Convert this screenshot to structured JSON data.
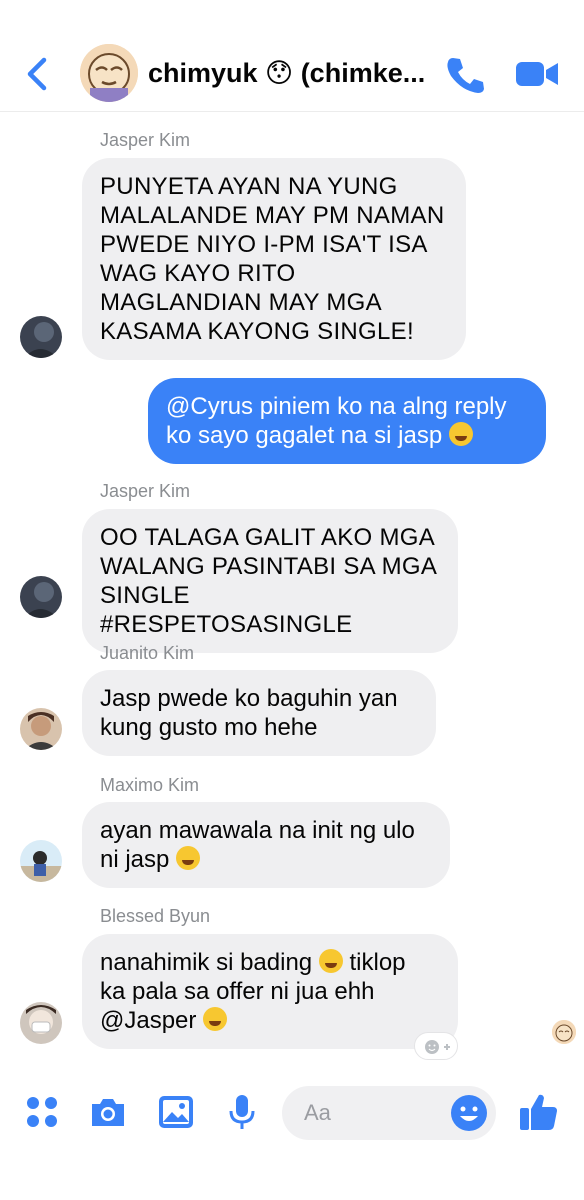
{
  "header": {
    "title": "chimyuk 😯 (chimke...",
    "accent_color": "#3a82f7"
  },
  "messages": [
    {
      "sender": "Jasper Kim",
      "text": "PUNYETA AYAN NA YUNG\nMALALANDE MAY PM NAMAN\nPWEDE NIYO I-PM ISA'T ISA\nWAG KAYO RITO\nMAGLANDIAN MAY MGA\nKASAMA KAYONG SINGLE!"
    },
    {
      "outgoing": true,
      "text": "@Cyrus piniem ko na alng reply ko sayo gagalet na si jasp",
      "emoji": "grinning-sweat-emoji"
    },
    {
      "sender": "Jasper Kim",
      "text": "OO TALAGA GALIT AKO MGA\nWALANG PASINTABI SA MGA\nSINGLE #RESPETOSASINGLE"
    },
    {
      "sender": "Juanito Kim",
      "text": "Jasp pwede ko baguhin yan\nkung gusto mo hehe"
    },
    {
      "sender": "Maximo Kim",
      "text_line1": "ayan mawawala na init ng ulo",
      "text_line2": "ni jasp",
      "emoji": "rofl-emoji"
    },
    {
      "sender": "Blessed Byun",
      "text_part1": "nanahimik si bading",
      "text_part2": "tiklop",
      "text_line2": "ka pala sa offer ni jua ehh",
      "text_line3": "@Jasper",
      "emoji1": "laughing-squint-emoji",
      "emoji2": "zany-face-emoji"
    }
  ],
  "composer": {
    "placeholder": "Aa"
  },
  "icons": {
    "back": "chevron-left-icon",
    "call": "phone-icon",
    "video": "video-camera-icon",
    "apps": "four-dots-icon",
    "camera": "camera-icon",
    "gallery": "image-icon",
    "mic": "microphone-icon",
    "emoji": "smiley-icon",
    "like": "thumbs-up-icon"
  }
}
